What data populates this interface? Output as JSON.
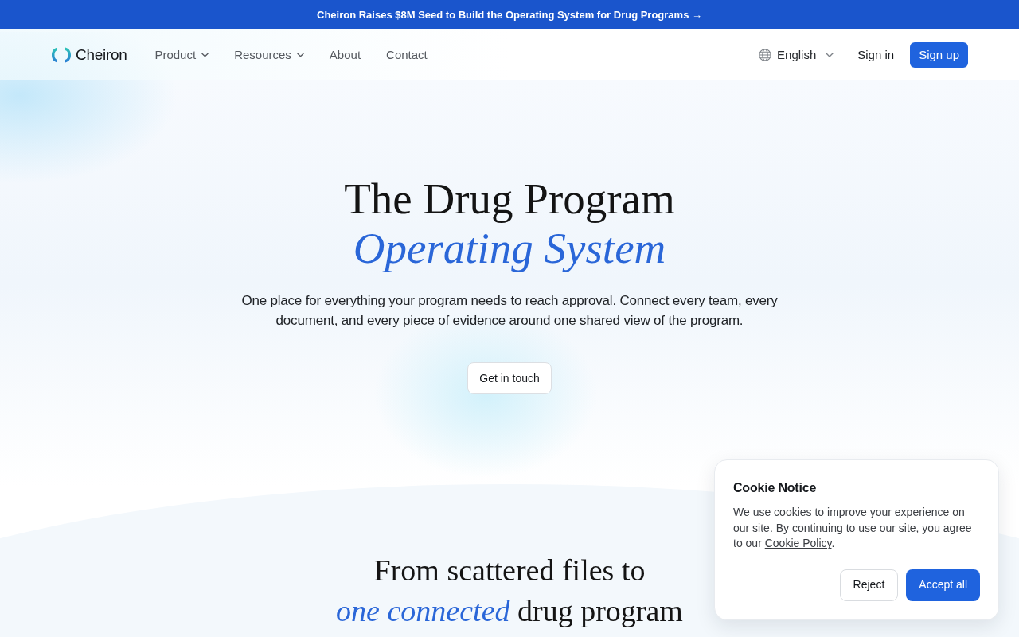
{
  "announcement": {
    "text": "Cheiron Raises $8M Seed to Build the Operating System for Drug Programs",
    "arrow": "→"
  },
  "nav": {
    "brand": "Cheiron",
    "links": [
      {
        "label": "Product",
        "dropdown": true
      },
      {
        "label": "Resources",
        "dropdown": true
      },
      {
        "label": "About",
        "dropdown": false
      },
      {
        "label": "Contact",
        "dropdown": false
      }
    ],
    "language": "English",
    "sign_in": "Sign in",
    "sign_up": "Sign up"
  },
  "hero": {
    "title": "The Drug Program",
    "title_accent": "Operating System",
    "description": "One place for everything your program needs to reach approval. Connect every team, every document, and every piece of evidence around one shared view of the program.",
    "cta": "Get in touch"
  },
  "section": {
    "heading_lines": [
      "From scattered files to",
      "*one connected* drug program"
    ]
  },
  "cookie_notice": {
    "title": "Cookie Notice",
    "text": "We use cookies to improve your experience on our site. By continuing to use our site, you agree to our",
    "link": "Cookie Policy",
    "text_end": ".",
    "buttons": [
      {
        "label": "Reject",
        "kind": "secondary"
      },
      {
        "label": "Accept all",
        "kind": "primary"
      }
    ]
  }
}
